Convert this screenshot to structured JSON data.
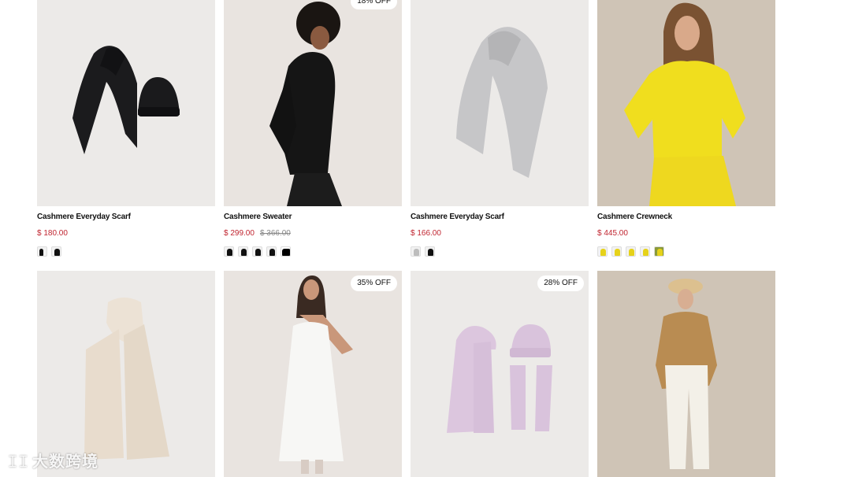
{
  "products_row1": [
    {
      "title": "Cashmere Everyday Scarf",
      "price": "$ 180.00",
      "old_price": "",
      "badge": "",
      "swatches": [
        "black-scarf",
        "black-set"
      ]
    },
    {
      "title": "Cashmere Sweater",
      "price": "$ 299.00",
      "old_price": "$ 366.00",
      "badge": "18% OFF",
      "swatches": [
        "black",
        "black",
        "black",
        "black",
        "black-dark"
      ]
    },
    {
      "title": "Cashmere Everyday Scarf",
      "price": "$ 166.00",
      "old_price": "",
      "badge": "",
      "swatches": [
        "grey",
        "black"
      ]
    },
    {
      "title": "Cashmere Crewneck",
      "price": "$ 445.00",
      "old_price": "",
      "badge": "",
      "swatches": [
        "yellow",
        "yellow",
        "yellow",
        "yellow",
        "yellow-green"
      ]
    }
  ],
  "products_row2": [
    {
      "badge": ""
    },
    {
      "badge": "35% OFF"
    },
    {
      "badge": "28% OFF"
    },
    {
      "badge": ""
    }
  ],
  "colors": {
    "sale_price": "#c0242f",
    "old_price": "#888888",
    "badge_bg": "#ffffff"
  },
  "watermark": {
    "logo": "ꀤꀤ",
    "text": "大数跨境"
  }
}
